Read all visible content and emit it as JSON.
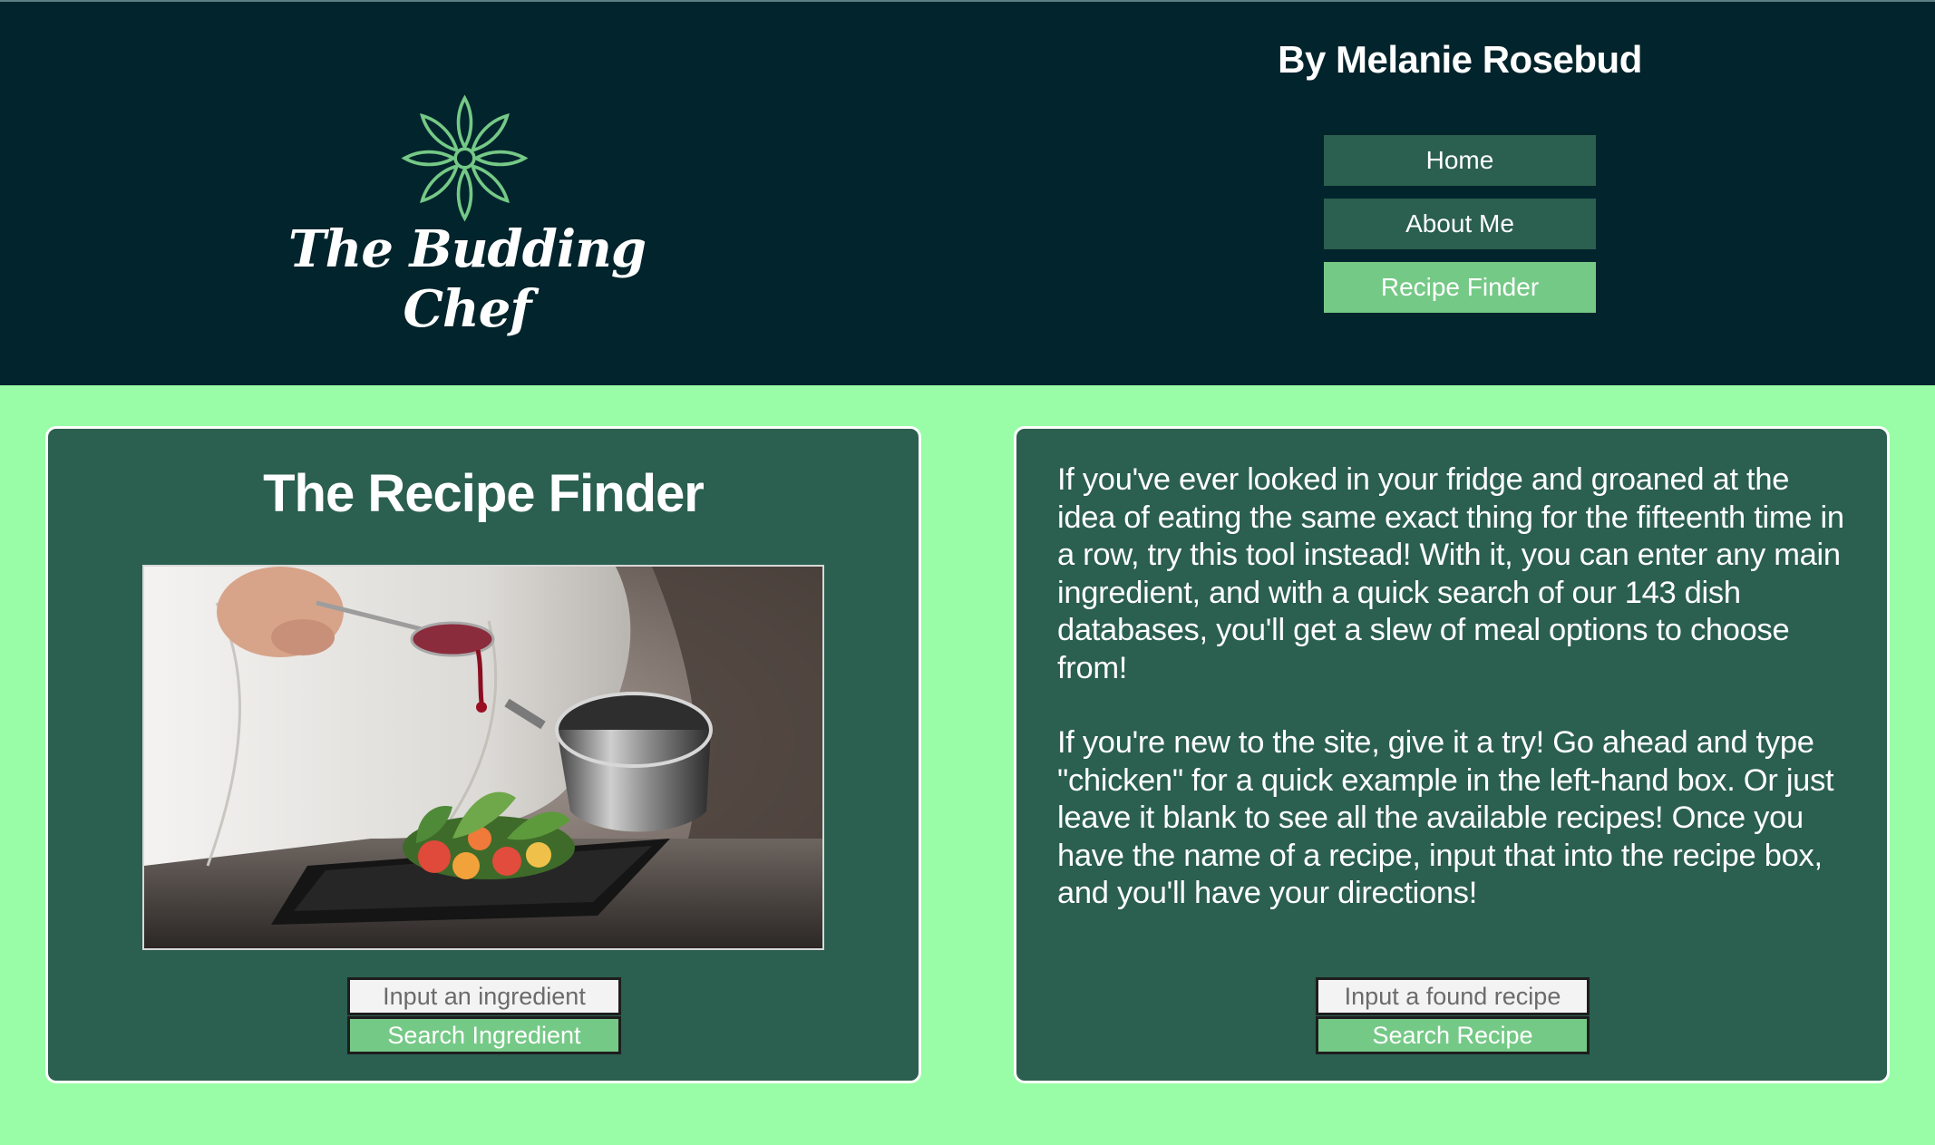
{
  "header": {
    "logo_text": "The Budding Chef",
    "author": "By Melanie Rosebud",
    "nav": [
      {
        "label": "Home"
      },
      {
        "label": "About Me"
      },
      {
        "label": "Recipe Finder"
      }
    ]
  },
  "finder": {
    "title": "The Recipe Finder",
    "image_alt": "Chef drizzling sauce over a plated salad",
    "ingredient_placeholder": "Input an ingredient",
    "ingredient_button": "Search Ingredient"
  },
  "info": {
    "paragraph1": "If you've ever looked in your fridge and groaned at the idea of eating the same exact thing for the fifteenth time in a row, try this tool instead! With it, you can enter any main ingredient, and with a quick search of our 143 dish databases, you'll get a slew of meal options to choose from!",
    "paragraph2": "If you're new to the site, give it a try! Go ahead and type \"chicken\" for a quick example in the left-hand box. Or just leave it blank to see all the available recipes! Once you have the name of a recipe, input that into the recipe box, and you'll have your directions!",
    "recipe_placeholder": "Input a found recipe",
    "recipe_button": "Search Recipe"
  },
  "colors": {
    "header_bg": "#02242c",
    "page_bg": "#98fda6",
    "panel_bg": "#2b5f4f",
    "accent": "#75c986"
  },
  "icons": {
    "logo": "flower-icon"
  }
}
